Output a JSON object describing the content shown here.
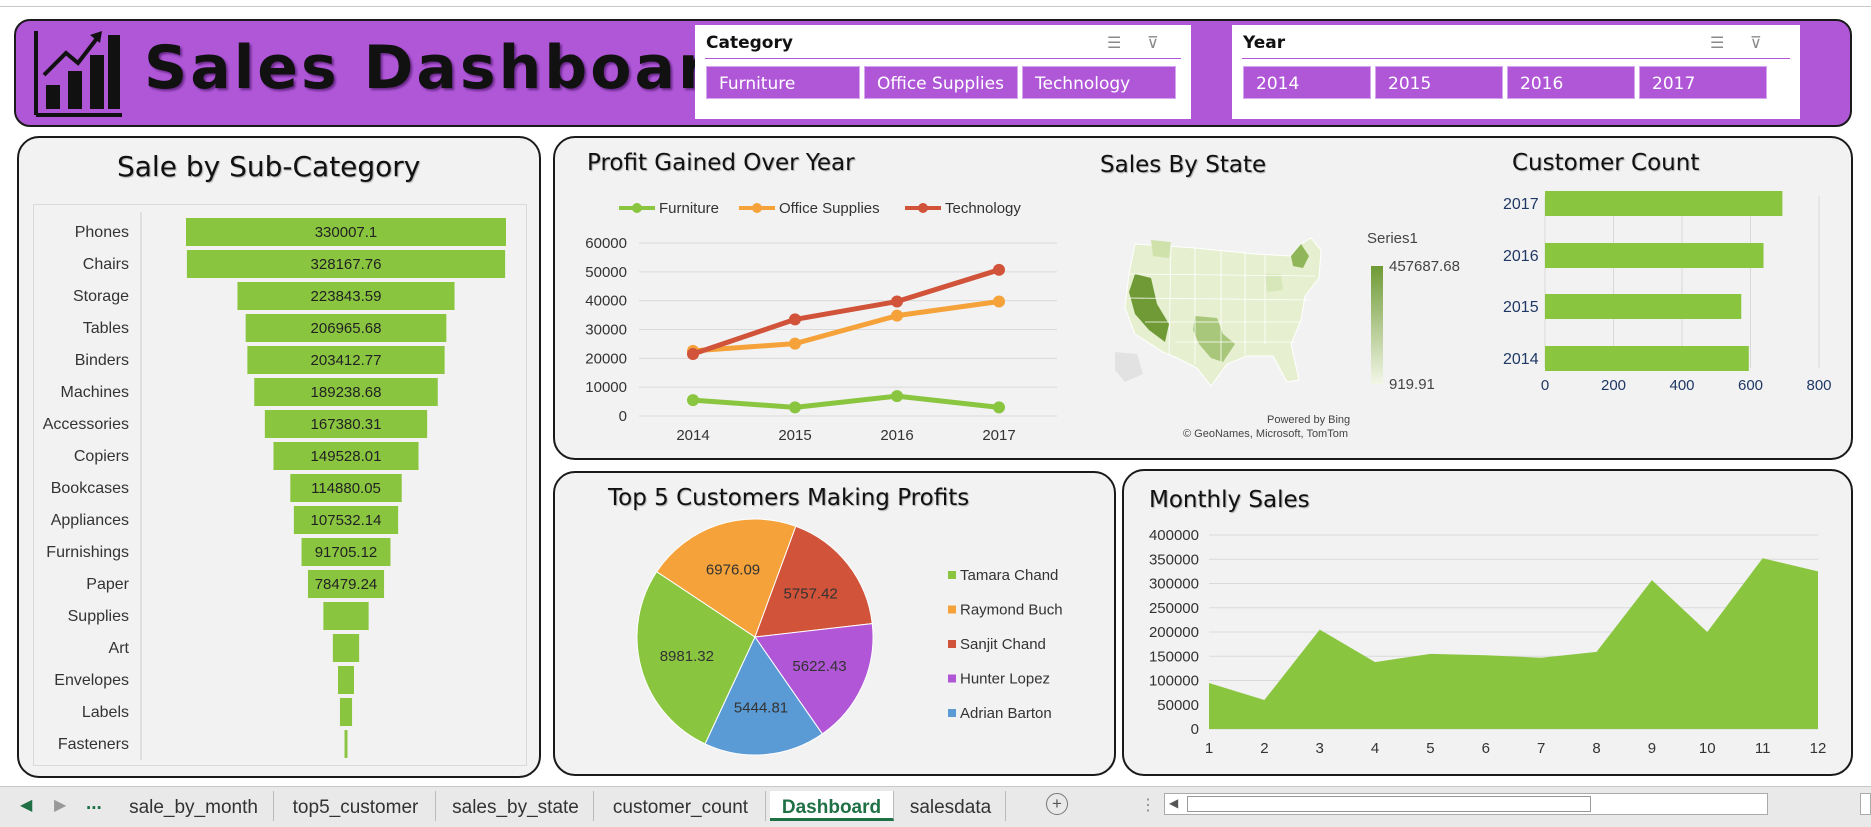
{
  "header": {
    "title": "Sales Dashboard",
    "category_slicer": {
      "title": "Category",
      "items": [
        "Furniture",
        "Office Supplies",
        "Technology"
      ]
    },
    "year_slicer": {
      "title": "Year",
      "items": [
        "2014",
        "2015",
        "2016",
        "2017"
      ]
    }
  },
  "colors": {
    "header": "#b057d8",
    "green": "#8ac540",
    "orange": "#f5a23a",
    "red": "#d0533a",
    "purple": "#b056d6",
    "blue": "#5b9bd5"
  },
  "subcategory": {
    "title": "Sale by Sub-Category",
    "chart_data": {
      "type": "bar",
      "categories": [
        "Phones",
        "Chairs",
        "Storage",
        "Tables",
        "Binders",
        "Machines",
        "Accessories",
        "Copiers",
        "Bookcases",
        "Appliances",
        "Furnishings",
        "Paper",
        "Supplies",
        "Art",
        "Envelopes",
        "Labels",
        "Fasteners"
      ],
      "values": [
        330007.1,
        328167.76,
        223843.59,
        206965.68,
        203412.77,
        189238.68,
        167380.31,
        149528.01,
        114880.05,
        107532.14,
        91705.12,
        78479.24,
        46673.54,
        27118.79,
        16476.4,
        12486.31,
        3024.28
      ],
      "value_labels": [
        "330007.1",
        "328167.76",
        "223843.59",
        "206965.68",
        "203412.77",
        "189238.68",
        "167380.31",
        "149528.01",
        "114880.05",
        "107532.14",
        "91705.12",
        "78479.24",
        "",
        "",
        "",
        "",
        ""
      ]
    }
  },
  "profit": {
    "title": "Profit Gained Over Year",
    "chart_data": {
      "type": "line",
      "categories": [
        "2014",
        "2015",
        "2016",
        "2017"
      ],
      "series": [
        {
          "name": "Furniture",
          "values": [
            5500,
            3000,
            6900,
            3000
          ]
        },
        {
          "name": "Office Supplies",
          "values": [
            22600,
            25100,
            34800,
            39700
          ]
        },
        {
          "name": "Technology",
          "values": [
            21500,
            33500,
            39700,
            50700
          ]
        }
      ],
      "ylim": [
        0,
        60000
      ],
      "yticks": [
        "60000",
        "50000",
        "40000",
        "30000",
        "20000",
        "10000",
        "0"
      ]
    }
  },
  "state_map": {
    "title": "Sales By State",
    "legend_title": "Series1",
    "max_label": "457687.68",
    "min_label": "919.91",
    "credit_1": "Powered by Bing",
    "credit_2": "© GeoNames, Microsoft, TomTom"
  },
  "customer_count": {
    "title": "Customer Count",
    "chart_data": {
      "type": "bar",
      "categories": [
        "2017",
        "2016",
        "2015",
        "2014"
      ],
      "values": [
        693,
        638,
        573,
        595
      ],
      "xlim": [
        0,
        800
      ],
      "xticks": [
        "0",
        "200",
        "400",
        "600",
        "800"
      ]
    }
  },
  "top5": {
    "title": "Top 5 Customers Making Profits",
    "chart_data": {
      "type": "pie",
      "labels": [
        "Tamara Chand",
        "Raymond Buch",
        "Sanjit Chand",
        "Hunter Lopez",
        "Adrian Barton"
      ],
      "values": [
        8981.32,
        6976.09,
        5757.42,
        5622.43,
        5444.81
      ],
      "value_labels": [
        "8981.32",
        "6976.09",
        "5757.42",
        "5622.43",
        "5444.81"
      ]
    }
  },
  "monthly": {
    "title": "Monthly Sales",
    "chart_data": {
      "type": "area",
      "categories": [
        "1",
        "2",
        "3",
        "4",
        "5",
        "6",
        "7",
        "8",
        "9",
        "10",
        "11",
        "12"
      ],
      "values": [
        94900,
        59800,
        205000,
        138000,
        155000,
        152000,
        147000,
        159000,
        307000,
        200000,
        352000,
        325000
      ],
      "ylim": [
        0,
        400000
      ],
      "yticks": [
        "400000",
        "350000",
        "300000",
        "250000",
        "200000",
        "150000",
        "100000",
        "50000",
        "0"
      ]
    }
  },
  "sheet_tabs": {
    "more": "...",
    "tabs": [
      "sale_by_month",
      "top5_customer",
      "sales_by_state",
      "customer_count",
      "Dashboard",
      "salesdata"
    ],
    "active": "Dashboard"
  }
}
